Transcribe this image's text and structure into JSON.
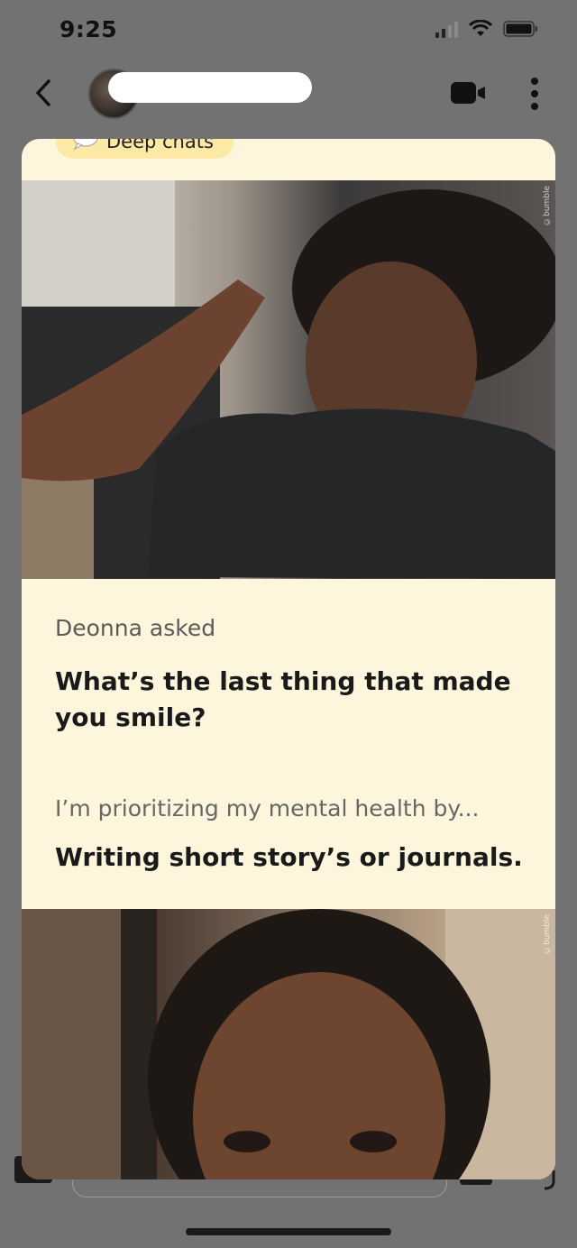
{
  "status_bar": {
    "time": "9:25"
  },
  "header": {
    "back_icon": "chevron-left-icon",
    "video_icon": "video-camera-icon",
    "more_icon": "vertical-dots-icon"
  },
  "card": {
    "chip_label": "Deep chats",
    "watermark": "©bumble",
    "question_1": {
      "asker": "Deonna asked",
      "question": "What’s the last thing that made you smile?"
    },
    "question_2": {
      "prompt": "I’m prioritizing my mental health by...",
      "answer": "Writing short story’s or journals."
    }
  },
  "colors": {
    "background": "#727272",
    "card": "#fef6dc",
    "chip": "#fde9a6",
    "text_dark": "#1a1a1a",
    "text_muted": "#666666"
  }
}
